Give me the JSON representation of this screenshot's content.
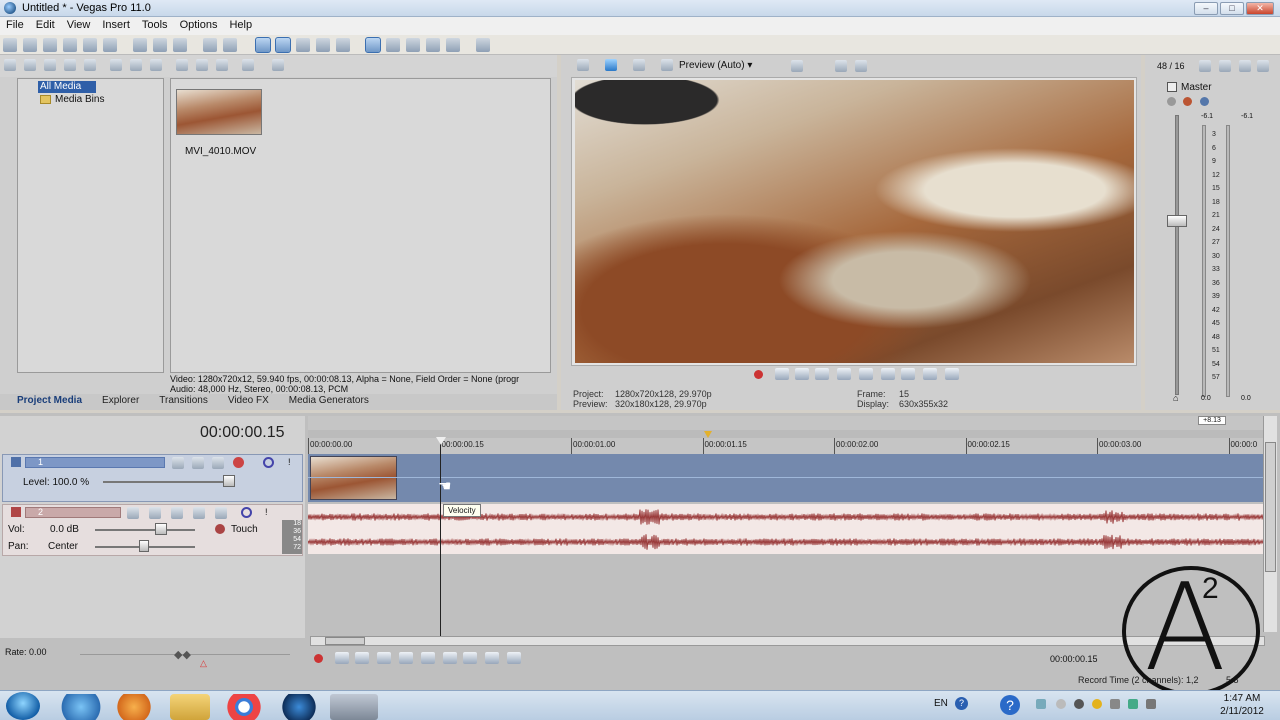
{
  "window": {
    "title": "Untitled * - Vegas Pro 11.0"
  },
  "menu": [
    "File",
    "Edit",
    "View",
    "Insert",
    "Tools",
    "Options",
    "Help"
  ],
  "media_panel": {
    "tree": [
      "All Media",
      "Media Bins"
    ],
    "thumbnail_label": "MVI_4010.MOV",
    "info_line1": "Video: 1280x720x12, 59.940 fps, 00:00:08.13, Alpha = None, Field Order = None (progr",
    "info_line2": "Audio: 48,000 Hz, Stereo, 00:00:08.13, PCM",
    "tabs": [
      "Project Media",
      "Explorer",
      "Transitions",
      "Video FX",
      "Media Generators"
    ]
  },
  "preview": {
    "mode": "Preview (Auto)",
    "project_label": "Project:",
    "project_value": "1280x720x128, 29.970p",
    "preview_label": "Preview:",
    "preview_value": "320x180x128, 29.970p",
    "frame_label": "Frame:",
    "frame_value": "15",
    "display_label": "Display:",
    "display_value": "630x355x32"
  },
  "master": {
    "count": "48 / 16",
    "label": "Master",
    "left_peak": "-6.1",
    "right_peak": "-6.1",
    "scale": [
      "3",
      "6",
      "9",
      "12",
      "15",
      "18",
      "21",
      "24",
      "27",
      "30",
      "33",
      "36",
      "39",
      "42",
      "45",
      "48",
      "51",
      "54",
      "57"
    ],
    "bottom_left": "0.0",
    "bottom_right": "0.0"
  },
  "timeline": {
    "timecode": "00:00:00.15",
    "end_marker": "+8.13",
    "ruler": [
      "00:00:00.00",
      "00:00:00.15",
      "00:00:01.00",
      "00:00:01.15",
      "00:00:02.00",
      "00:00:02.15",
      "00:00:03.00",
      "00:00:0"
    ],
    "video_track": {
      "number": "1",
      "level": "Level: 100.0 %"
    },
    "audio_track": {
      "number": "2",
      "vol_label": "Vol:",
      "vol_value": "0.0 dB",
      "pan_label": "Pan:",
      "pan_value": "Center",
      "automation": "Touch",
      "meter_labels": [
        "18",
        "36",
        "54",
        "72"
      ]
    },
    "tooltip": "Velocity",
    "rate": "Rate: 0.00",
    "bottom_timecode": "00:00:00.15",
    "record_time": "Record Time (2 channels): 1,2",
    "record_time_tail": "5:5"
  },
  "watermark": {
    "letter": "A",
    "superscript": "2"
  },
  "taskbar": {
    "lang": "EN",
    "time": "1:47 AM",
    "date": "2/11/2012"
  }
}
